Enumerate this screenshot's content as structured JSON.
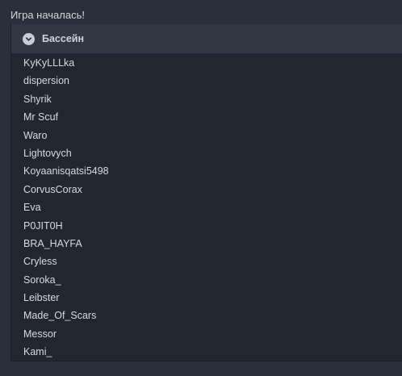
{
  "message": "Игра началась!",
  "section": {
    "title": "Бассейн",
    "icon": "chevron-down-icon",
    "players": [
      "KyKyLLLka",
      "dispersion",
      "Shyrik",
      "Mr Scuf",
      "Waro",
      "Lightovych",
      "Koyaanisqatsi5498",
      "CorvusCorax",
      "Eva",
      "P0JIT0H",
      "BRA_HAYFA",
      "Cryless",
      "Soroka_",
      "Leibster",
      "Made_Of_Scars",
      "Messor",
      "Kami_"
    ]
  },
  "colors": {
    "background": "#2b2f3b",
    "panel": "#222631",
    "header": "#323744",
    "text": "#d8dade"
  }
}
